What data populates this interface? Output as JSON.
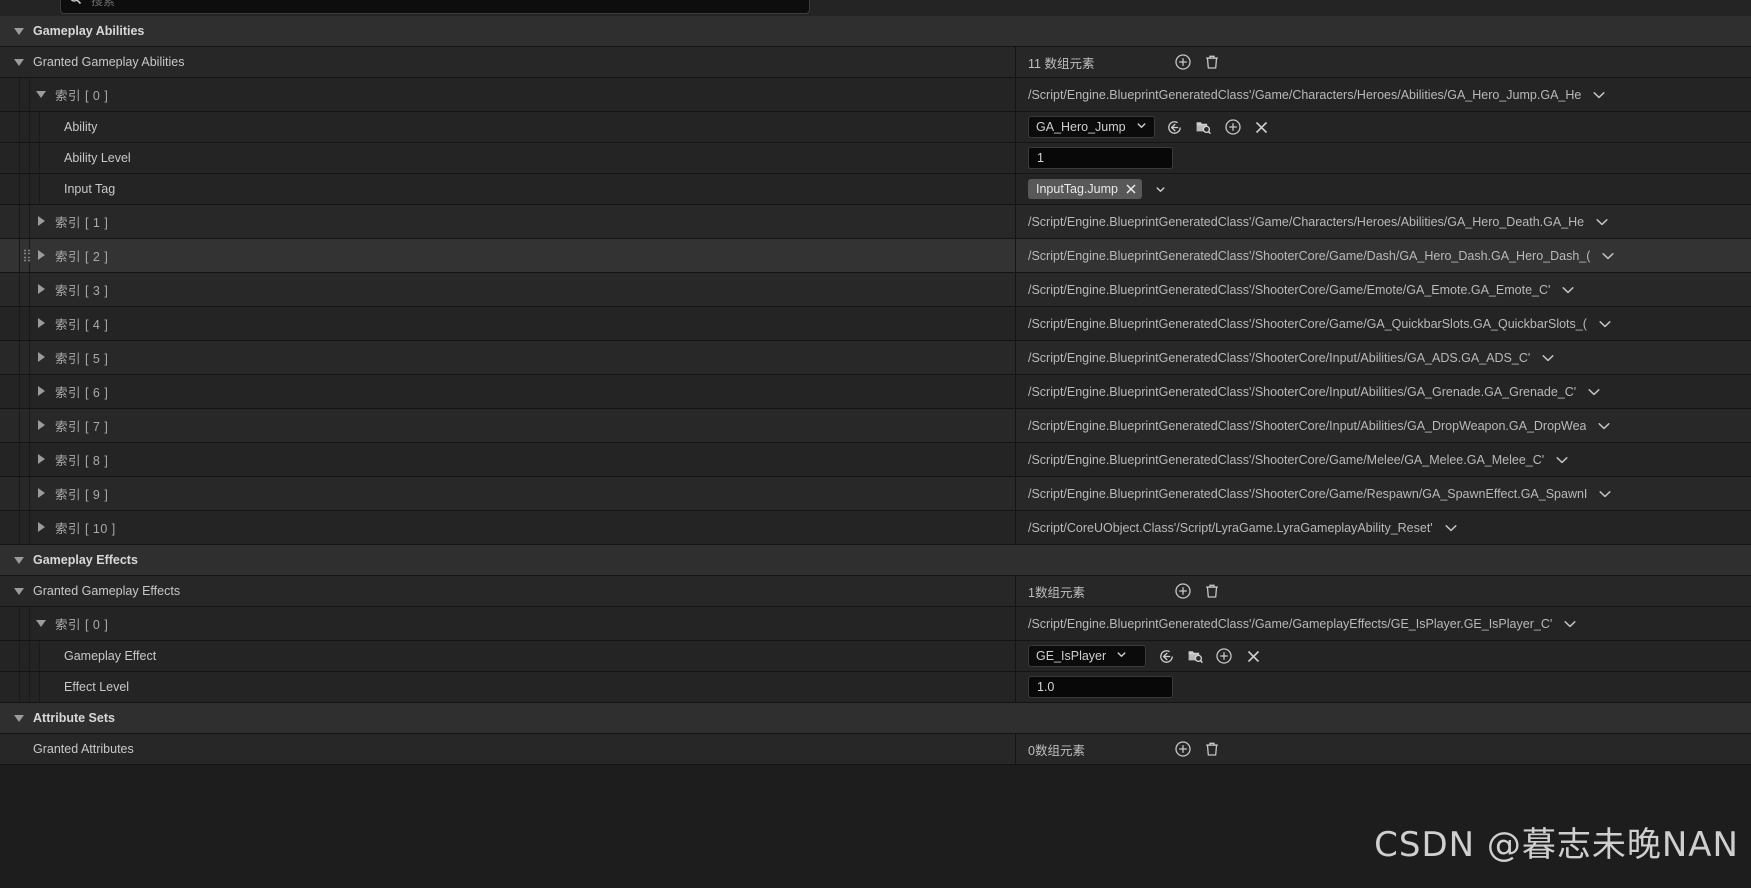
{
  "search": {
    "placeholder": "搜索",
    "value": "",
    "icon": "search-icon"
  },
  "watermark": "CSDN @暮志未晚NAN",
  "icons": {
    "expand_down": "triangle-down-icon",
    "expand_right": "triangle-right-icon",
    "add": "add-circle-icon",
    "delete": "trash-icon",
    "use_selected": "use-selected-asset-icon",
    "browse": "browse-to-asset-icon",
    "clear": "clear-x-icon",
    "dropdown": "chevron-down-icon",
    "drag": "drag-handle-icon"
  },
  "sections": [
    {
      "id": "gameplay-abilities",
      "title": "Gameplay Abilities",
      "array_property": {
        "label": "Granted Gameplay Abilities",
        "count_text": "11 数组元素",
        "add_label": "添加元素",
        "delete_label": "删除全部"
      },
      "elements": [
        {
          "index_label": "索引 [ 0 ]",
          "expanded": true,
          "path": "/Script/Engine.BlueprintGeneratedClass'/Game/Characters/Heroes/Abilities/GA_Hero_Jump.GA_He",
          "children": [
            {
              "label": "Ability",
              "type": "asset",
              "value": "GA_Hero_Jump"
            },
            {
              "label": "Ability Level",
              "type": "number",
              "value": "1"
            },
            {
              "label": "Input Tag",
              "type": "tag",
              "value": "InputTag.Jump"
            }
          ]
        },
        {
          "index_label": "索引 [ 1 ]",
          "expanded": false,
          "path": "/Script/Engine.BlueprintGeneratedClass'/Game/Characters/Heroes/Abilities/GA_Hero_Death.GA_He"
        },
        {
          "index_label": "索引 [ 2 ]",
          "expanded": false,
          "hovered": true,
          "path": "/Script/Engine.BlueprintGeneratedClass'/ShooterCore/Game/Dash/GA_Hero_Dash.GA_Hero_Dash_("
        },
        {
          "index_label": "索引 [ 3 ]",
          "expanded": false,
          "path": "/Script/Engine.BlueprintGeneratedClass'/ShooterCore/Game/Emote/GA_Emote.GA_Emote_C'"
        },
        {
          "index_label": "索引 [ 4 ]",
          "expanded": false,
          "path": "/Script/Engine.BlueprintGeneratedClass'/ShooterCore/Game/GA_QuickbarSlots.GA_QuickbarSlots_("
        },
        {
          "index_label": "索引 [ 5 ]",
          "expanded": false,
          "path": "/Script/Engine.BlueprintGeneratedClass'/ShooterCore/Input/Abilities/GA_ADS.GA_ADS_C'"
        },
        {
          "index_label": "索引 [ 6 ]",
          "expanded": false,
          "path": "/Script/Engine.BlueprintGeneratedClass'/ShooterCore/Input/Abilities/GA_Grenade.GA_Grenade_C'"
        },
        {
          "index_label": "索引 [ 7 ]",
          "expanded": false,
          "path": "/Script/Engine.BlueprintGeneratedClass'/ShooterCore/Input/Abilities/GA_DropWeapon.GA_DropWea"
        },
        {
          "index_label": "索引 [ 8 ]",
          "expanded": false,
          "path": "/Script/Engine.BlueprintGeneratedClass'/ShooterCore/Game/Melee/GA_Melee.GA_Melee_C'"
        },
        {
          "index_label": "索引 [ 9 ]",
          "expanded": false,
          "path": "/Script/Engine.BlueprintGeneratedClass'/ShooterCore/Game/Respawn/GA_SpawnEffect.GA_SpawnI"
        },
        {
          "index_label": "索引 [ 10 ]",
          "expanded": false,
          "path": "/Script/CoreUObject.Class'/Script/LyraGame.LyraGameplayAbility_Reset'"
        }
      ]
    },
    {
      "id": "gameplay-effects",
      "title": "Gameplay Effects",
      "array_property": {
        "label": "Granted Gameplay Effects",
        "count_text": "1数组元素",
        "add_label": "添加元素",
        "delete_label": "删除全部"
      },
      "elements": [
        {
          "index_label": "索引 [ 0 ]",
          "expanded": true,
          "path": "/Script/Engine.BlueprintGeneratedClass'/Game/GameplayEffects/GE_IsPlayer.GE_IsPlayer_C'",
          "children": [
            {
              "label": "Gameplay Effect",
              "type": "asset",
              "value": "GE_IsPlayer"
            },
            {
              "label": "Effect Level",
              "type": "number",
              "value": "1.0"
            }
          ]
        }
      ]
    },
    {
      "id": "attribute-sets",
      "title": "Attribute Sets",
      "array_property": {
        "label": "Granted Attributes",
        "count_text": "0数组元素",
        "add_label": "添加元素",
        "delete_label": "删除全部"
      },
      "elements": []
    }
  ]
}
